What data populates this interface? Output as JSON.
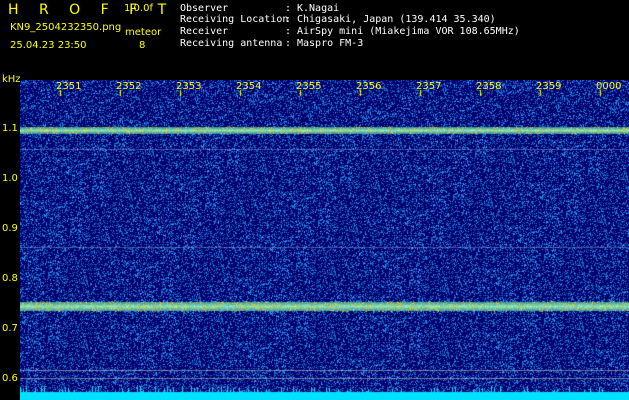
{
  "header": {
    "app_name": "H R O F F T",
    "version": "1.0.0f",
    "file_name": "KN9_2504232350.png",
    "meteor_label": "meteor",
    "meteor_count": "8",
    "datetime": "25.04.23 23:50"
  },
  "info": [
    {
      "label": "Observer",
      "value": "K.Nagai"
    },
    {
      "label": "Receiving Location",
      "value": "Chigasaki, Japan (139.414 35.340)"
    },
    {
      "label": "Receiver",
      "value": "AirSpy mini (Miakejima VOR 108.65MHz)"
    },
    {
      "label": "Receiving antenna",
      "value": "Maspro FM-3"
    }
  ],
  "axis": {
    "y_unit": "kHz",
    "y_ticks": [
      "1.1",
      "1.0",
      "0.9",
      "0.8",
      "0.7",
      "0.6"
    ],
    "x_ticks": [
      "2351",
      "2352",
      "2353",
      "2354",
      "2355",
      "2356",
      "2357",
      "2358",
      "2359",
      "0000"
    ]
  },
  "colors": {
    "label": "#ffff00",
    "info_text": "#ffffff",
    "background": "#00006e",
    "signal": "#40c8a0",
    "baseline": "#00e0ff"
  }
}
